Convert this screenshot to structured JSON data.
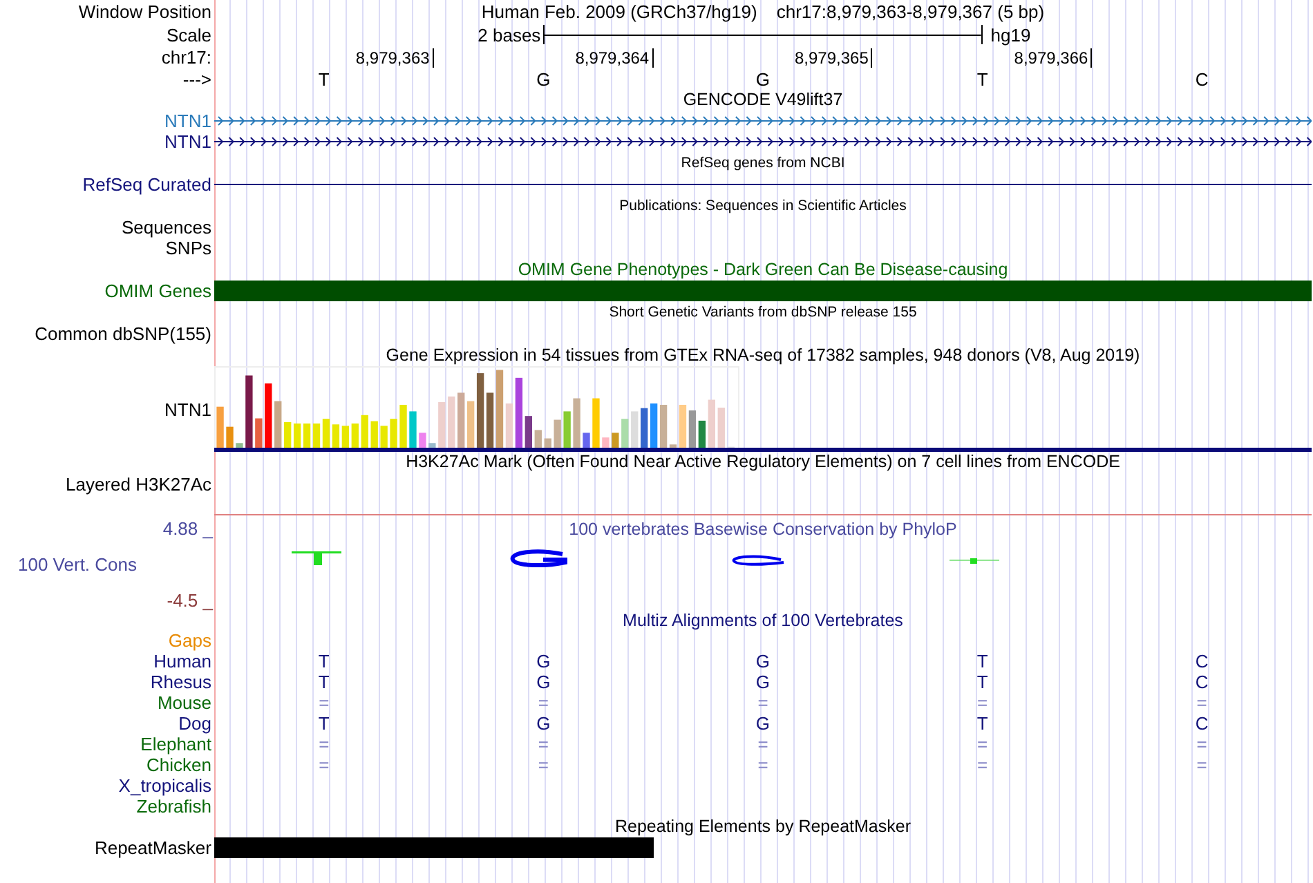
{
  "header": {
    "label": "Window Position",
    "assembly": "Human Feb. 2009 (GRCh37/hg19)",
    "position": "chr17:8,979,363-8,979,367 (5 bp)"
  },
  "scale": {
    "label": "Scale",
    "length": "2 bases",
    "assembly": "hg19"
  },
  "ruler": {
    "label": "chr17:",
    "ticks": [
      "8,979,363",
      "8,979,364",
      "8,979,365",
      "8,979,366"
    ]
  },
  "sequence": {
    "label": "--->",
    "bases": [
      "T",
      "G",
      "G",
      "T",
      "C"
    ]
  },
  "tracks": [
    {
      "kind": "genes",
      "title": "GENCODE V49lift37",
      "genes": [
        {
          "name": "NTN1",
          "color": "#2b7bba"
        },
        {
          "name": "NTN1",
          "color": "#14147c"
        }
      ]
    },
    {
      "kind": "refseq",
      "title": "RefSeq genes from NCBI",
      "label": "RefSeq Curated"
    },
    {
      "kind": "labels",
      "title": "Publications: Sequences in Scientific Articles",
      "labels": [
        "Sequences",
        "SNPs"
      ]
    },
    {
      "kind": "omim",
      "title": "OMIM Gene Phenotypes - Dark Green Can Be Disease-causing",
      "label": "OMIM Genes"
    },
    {
      "kind": "labels",
      "title": "Short Genetic Variants from dbSNP release 155",
      "labels": [
        "Common dbSNP(155)"
      ]
    },
    {
      "kind": "expression",
      "title": "Gene Expression in 54 tissues from GTEx RNA-seq of 17382 samples, 948 donors (V8, Aug 2019)",
      "label": "NTN1"
    },
    {
      "kind": "layered",
      "title": "H3K27Ac Mark (Often Found Near Active Regulatory Elements) on 7 cell lines from ENCODE",
      "label": "Layered H3K27Ac"
    },
    {
      "kind": "conservation",
      "title": "100 vertebrates Basewise Conservation by PhyloP",
      "label": "100 Vert. Cons",
      "max": "4.88 _",
      "min": "-4.5 _"
    },
    {
      "kind": "multiz",
      "title": "Multiz Alignments of 100 Vertebrates",
      "species": [
        {
          "name": "Gaps",
          "color": "#e88a00",
          "kind": "empty"
        },
        {
          "name": "Human",
          "color": "#14147c",
          "kind": "bases",
          "bases": [
            "T",
            "G",
            "G",
            "T",
            "C"
          ]
        },
        {
          "name": "Rhesus",
          "color": "#14147c",
          "kind": "bases",
          "bases": [
            "T",
            "G",
            "G",
            "T",
            "C"
          ]
        },
        {
          "name": "Mouse",
          "color": "#0a6a0a",
          "kind": "matches",
          "bases": [
            "=",
            "=",
            "=",
            "=",
            "="
          ]
        },
        {
          "name": "Dog",
          "color": "#14147c",
          "kind": "bases",
          "bases": [
            "T",
            "G",
            "G",
            "T",
            "C"
          ]
        },
        {
          "name": "Elephant",
          "color": "#0a6a0a",
          "kind": "matches",
          "bases": [
            "=",
            "=",
            "=",
            "=",
            "="
          ]
        },
        {
          "name": "Chicken",
          "color": "#0a6a0a",
          "kind": "matches",
          "bases": [
            "=",
            "=",
            "=",
            "=",
            "="
          ]
        },
        {
          "name": "X_tropicalis",
          "color": "#14147c",
          "kind": "empty"
        },
        {
          "name": "Zebrafish",
          "color": "#0a6a0a",
          "kind": "empty"
        }
      ]
    },
    {
      "kind": "repeat",
      "title": "Repeating Elements by RepeatMasker",
      "label": "RepeatMasker"
    }
  ]
}
